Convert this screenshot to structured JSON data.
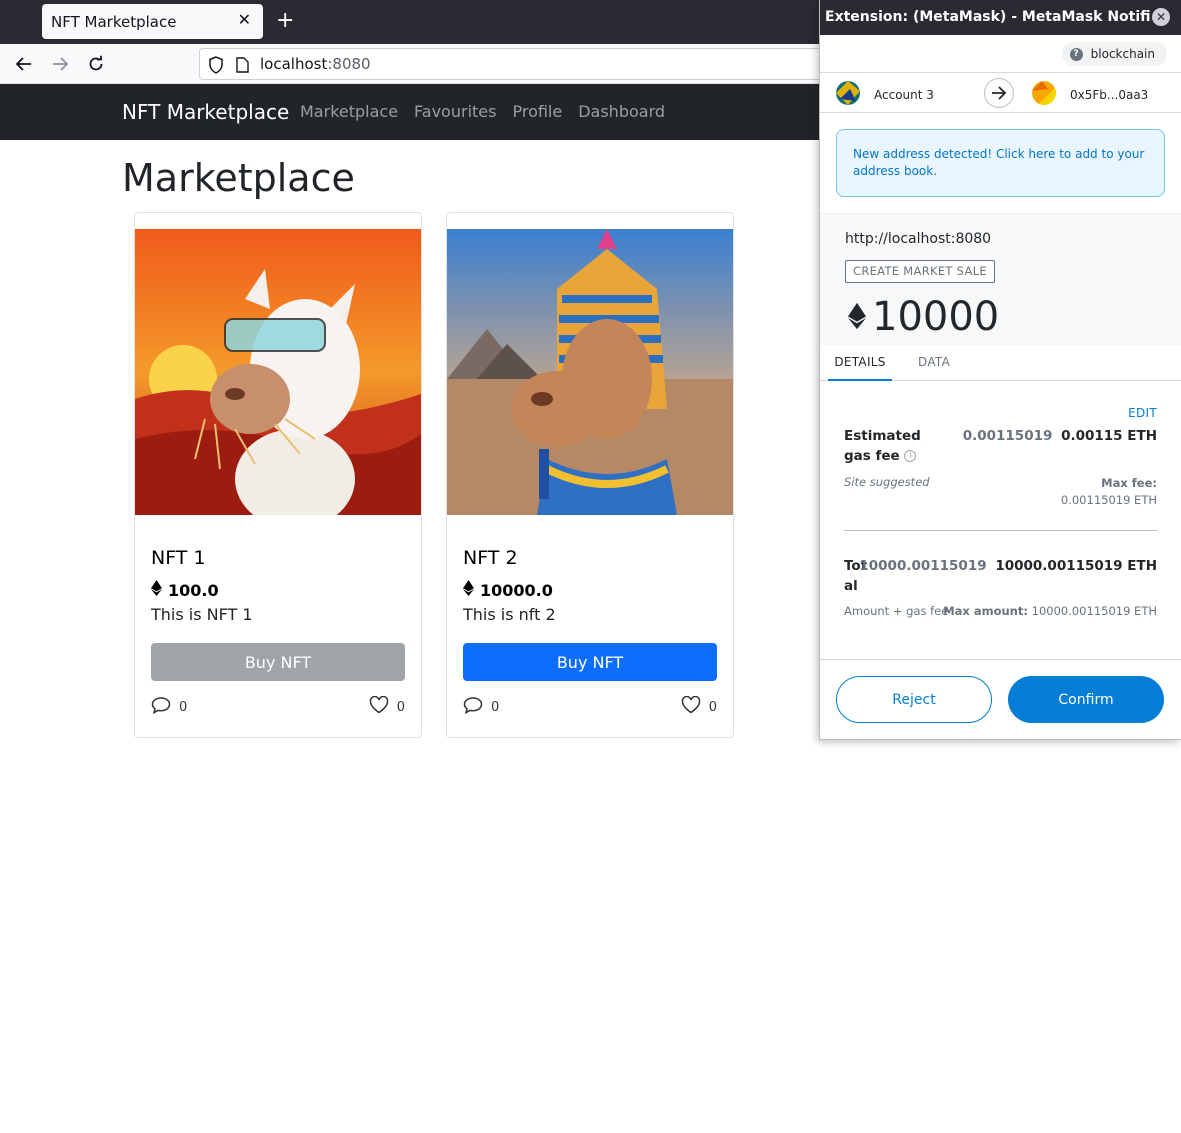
{
  "browser": {
    "tab_title": "NFT Marketplace",
    "tab_close": "✕",
    "new_tab": "+",
    "url_host": "localhost",
    "url_port": ":8080"
  },
  "site": {
    "brand": "NFT Marketplace",
    "nav": [
      "Marketplace",
      "Favourites",
      "Profile",
      "Dashboard"
    ],
    "page_title": "Marketplace"
  },
  "cards": [
    {
      "name": "NFT 1",
      "price": "100.0",
      "description": "This is NFT 1",
      "button": "Buy NFT",
      "button_state": "disabled",
      "comments": "0",
      "likes": "0"
    },
    {
      "name": "NFT 2",
      "price": "10000.0",
      "description": "This is nft 2",
      "button": "Buy NFT",
      "button_state": "enabled",
      "comments": "0",
      "likes": "0"
    }
  ],
  "metamask": {
    "window_title": "Extension: (MetaMask) - MetaMask Notification",
    "network": "blockchain",
    "from_account": "Account 3",
    "to_address": "0x5Fb...0aa3",
    "notice": "New address detected! Click here to add to your address book.",
    "origin": "http://localhost:8080",
    "method": "CREATE MARKET SALE",
    "amount": "10000",
    "tabs": [
      "DETAILS",
      "DATA"
    ],
    "edit": "EDIT",
    "gas_label": "Estimated gas fee",
    "gas_secondary": "0.00115019",
    "gas_primary": "0.00115 ETH",
    "site_suggested": "Site suggested",
    "max_fee_label": "Max fee:",
    "max_fee_value": "0.00115019 ETH",
    "total_label": "Total",
    "total_secondary": "10000.00115019",
    "total_primary": "10000.00115019 ETH",
    "amount_plus_gas": "Amount + gas fee",
    "max_amount_label": "Max amount:",
    "max_amount_value": "10000.00115019 ETH",
    "reject": "Reject",
    "confirm": "Confirm"
  },
  "colors": {
    "primary_button": "#0d6efd",
    "disabled_button": "#a0a4a8",
    "metamask_blue": "#037dd6",
    "navbar": "#212529"
  }
}
